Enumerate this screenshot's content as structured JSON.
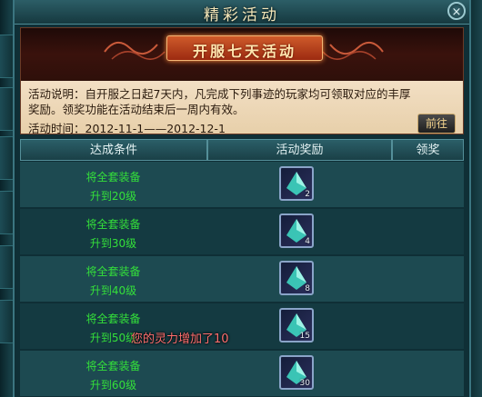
{
  "window": {
    "title": "精彩活动",
    "close_label": "×"
  },
  "banner": {
    "title": "开服七天活动",
    "description_label": "活动说明：",
    "description": "自开服之日起7天内，凡完成下列事迹的玩家均可领取对应的丰厚奖励。领奖功能在活动结束后一周内有效。",
    "time_label": "活动时间：",
    "time_value": "2012-11-1——2012-12-1",
    "goto_label": "前往"
  },
  "table": {
    "headers": [
      "达成条件",
      "活动奖励",
      "领奖"
    ],
    "rows": [
      {
        "line1": "将全套装备",
        "line2": "升到20级",
        "qty": "2"
      },
      {
        "line1": "将全套装备",
        "line2": "升到30级",
        "qty": "4"
      },
      {
        "line1": "将全套装备",
        "line2": "升到40级",
        "qty": "8"
      },
      {
        "line1": "将全套装备",
        "line2": "升到50级",
        "qty": "15"
      },
      {
        "line1": "将全套装备",
        "line2": "升到60级",
        "qty": "30"
      }
    ]
  },
  "notice": "您的灵力增加了10",
  "icons": {
    "reward": "equipment-upgrade-stone-icon"
  },
  "colors": {
    "accent": "#34e03a",
    "notice": "#ff6f6f",
    "title": "#f3e6b8"
  }
}
